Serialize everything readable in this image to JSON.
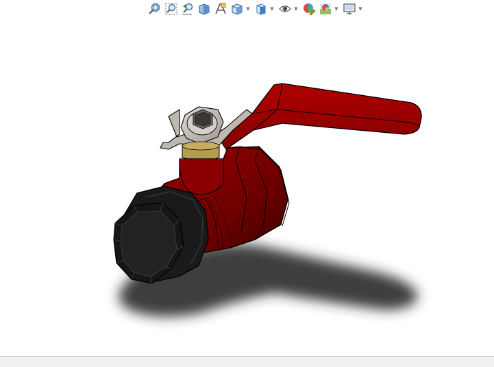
{
  "window": {
    "view": "graphics-area"
  },
  "toolbar": {
    "items": [
      {
        "icon": "zoom-to-fit-icon"
      },
      {
        "icon": "zoom-to-area-icon"
      },
      {
        "icon": "previous-view-icon"
      },
      {
        "icon": "section-view-icon"
      },
      {
        "icon": "dynamic-annotation-views-icon"
      },
      {
        "icon": "view-orientation-icon",
        "dropdown": true
      },
      {
        "icon": "display-style-icon",
        "dropdown": true
      },
      {
        "icon": "hide-show-items-icon",
        "dropdown": true
      },
      {
        "icon": "edit-appearance-icon"
      },
      {
        "icon": "apply-scene-icon",
        "dropdown": true
      },
      {
        "icon": "view-settings-icon",
        "dropdown": true
      }
    ]
  },
  "model": {
    "name": "ball-valve",
    "colors": {
      "body": "#7a0000",
      "body_dark": "#4a0000",
      "handle": "#9b0000",
      "nut": "#c8c4bc",
      "fitting": "#1a1a1a",
      "brass": "#b89a52",
      "shadow": "#2a2a2a",
      "edge": "#000000"
    }
  }
}
